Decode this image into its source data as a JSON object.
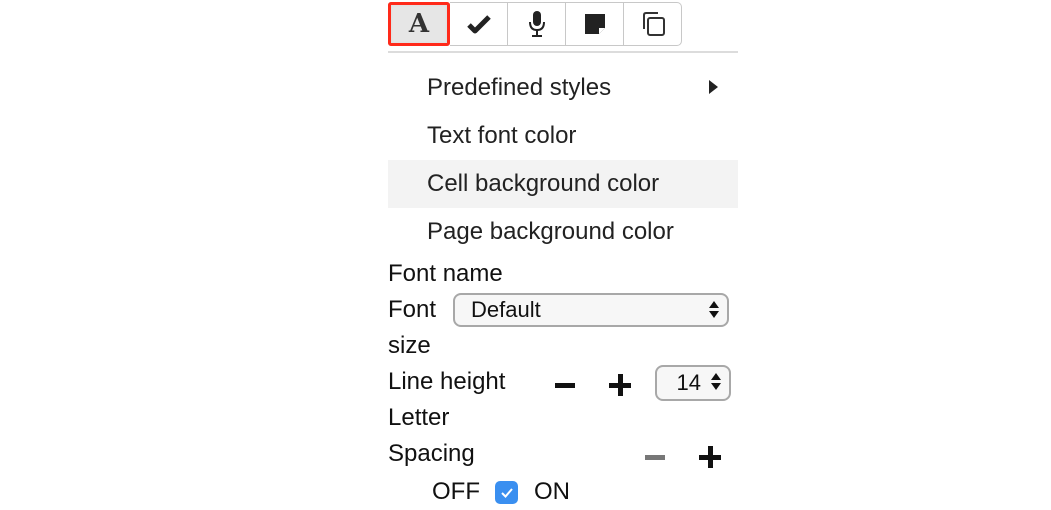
{
  "toolbar": {
    "buttons": [
      {
        "name": "text-style",
        "icon": "font-A-icon",
        "active": true
      },
      {
        "name": "checkmark",
        "icon": "checkmark-icon"
      },
      {
        "name": "microphone",
        "icon": "microphone-icon"
      },
      {
        "name": "sticky-note",
        "icon": "sticky-note-icon"
      },
      {
        "name": "copy",
        "icon": "copy-icon"
      }
    ],
    "active_highlight_color": "#ff2a1a"
  },
  "menu": {
    "items": [
      {
        "label": "Predefined styles",
        "submenu": true
      },
      {
        "label": "Text font color"
      },
      {
        "label": "Cell background color",
        "hovered": true
      },
      {
        "label": "Page background color"
      }
    ]
  },
  "font": {
    "name_label": "Font name",
    "size_label_line1": "Font",
    "size_label_line2": "size",
    "selected": "Default"
  },
  "line_height": {
    "label": "Line height",
    "value": "14"
  },
  "letter_spacing": {
    "label_line1": "Letter",
    "label_line2": "Spacing",
    "off_label": "OFF",
    "on_label": "ON",
    "checked": true,
    "checkbox_color": "#3a8ff0"
  }
}
